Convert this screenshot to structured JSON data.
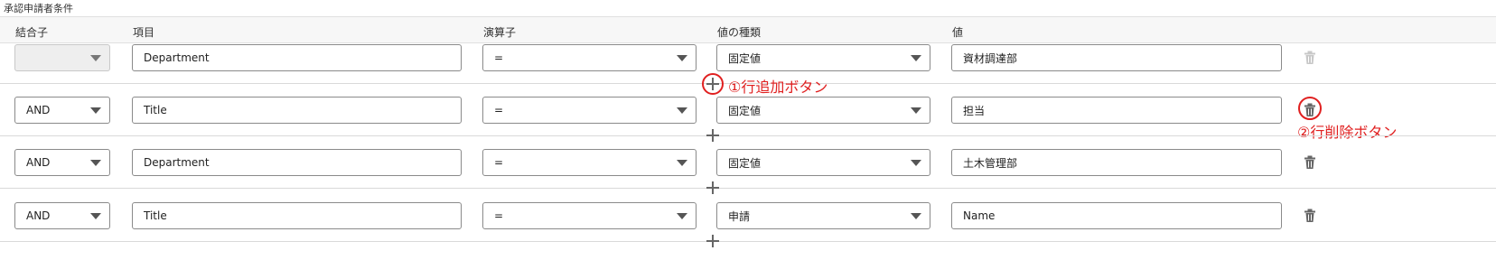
{
  "section_title": "承認申請者条件",
  "headers": {
    "connector": "結合子",
    "item": "項目",
    "operator": "演算子",
    "value_type": "値の種類",
    "value": "値"
  },
  "rows": [
    {
      "connector": "",
      "item": "Department",
      "operator": "=",
      "value_type": "固定値",
      "value": "資材調達部"
    },
    {
      "connector": "AND",
      "item": "Title",
      "operator": "=",
      "value_type": "固定値",
      "value": "担当"
    },
    {
      "connector": "AND",
      "item": "Department",
      "operator": "=",
      "value_type": "固定値",
      "value": "土木管理部"
    },
    {
      "connector": "AND",
      "item": "Title",
      "operator": "=",
      "value_type": "申請",
      "value": "Name"
    }
  ],
  "annotations": {
    "add_row": "①行追加ボタン",
    "delete_row": "②行削除ボタン"
  },
  "icons": {
    "add": "plus-icon",
    "delete": "trash-icon"
  },
  "colors": {
    "annotation": "#e02020",
    "header_bg": "#f7f7f7"
  }
}
